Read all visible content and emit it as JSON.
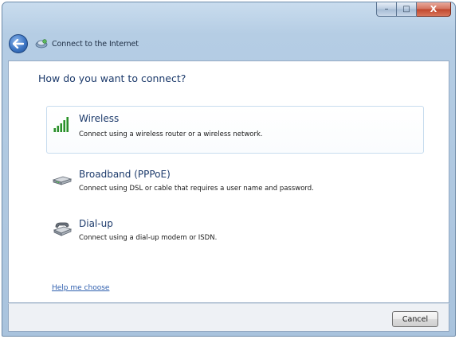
{
  "window": {
    "title": "Connect to the Internet",
    "caption_buttons": {
      "minimize": "–",
      "maximize": "□",
      "close": "X"
    }
  },
  "page": {
    "heading": "How do you want to connect?"
  },
  "options": [
    {
      "title": "Wireless",
      "description": "Connect using a wireless router or a wireless network.",
      "icon": "wireless-signal-icon",
      "highlighted": true
    },
    {
      "title": "Broadband (PPPoE)",
      "description": "Connect using DSL or cable that requires a user name and password.",
      "icon": "broadband-modem-icon",
      "highlighted": false
    },
    {
      "title": "Dial-up",
      "description": "Connect using a dial-up modem or ISDN.",
      "icon": "dialup-phone-icon",
      "highlighted": false
    }
  ],
  "help_link": "Help me choose",
  "footer": {
    "cancel_label": "Cancel"
  },
  "colors": {
    "heading": "#1c3a6b",
    "link": "#2f5fae",
    "close_button": "#c0462c",
    "signal_green": "#2e8b2e"
  }
}
